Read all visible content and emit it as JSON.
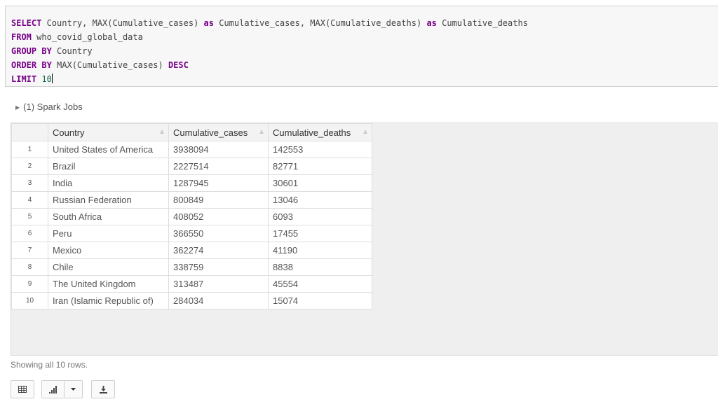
{
  "code": {
    "line1": {
      "kw1": "SELECT",
      "t1": " Country, MAX(Cumulative_cases) ",
      "kw2": "as",
      "t2": " Cumulative_cases, MAX(Cumulative_deaths) ",
      "kw3": "as",
      "t3": " Cumulative_deaths"
    },
    "line2": {
      "kw": "FROM",
      "t": " who_covid_global_data"
    },
    "line3": {
      "kw": "GROUP BY",
      "t": " Country"
    },
    "line4": {
      "kw": "ORDER BY",
      "t": " MAX(Cumulative_cases) ",
      "kw2": "DESC"
    },
    "line5": {
      "kw": "LIMIT",
      "t": " ",
      "num": "10"
    }
  },
  "spark_jobs": {
    "label": "(1) Spark Jobs"
  },
  "table": {
    "headers": [
      "Country",
      "Cumulative_cases",
      "Cumulative_deaths"
    ],
    "rows": [
      {
        "idx": "1",
        "country": "United States of America",
        "cases": "3938094",
        "deaths": "142553"
      },
      {
        "idx": "2",
        "country": "Brazil",
        "cases": "2227514",
        "deaths": "82771"
      },
      {
        "idx": "3",
        "country": "India",
        "cases": "1287945",
        "deaths": "30601"
      },
      {
        "idx": "4",
        "country": "Russian Federation",
        "cases": "800849",
        "deaths": "13046"
      },
      {
        "idx": "5",
        "country": "South Africa",
        "cases": "408052",
        "deaths": "6093"
      },
      {
        "idx": "6",
        "country": "Peru",
        "cases": "366550",
        "deaths": "17455"
      },
      {
        "idx": "7",
        "country": "Mexico",
        "cases": "362274",
        "deaths": "41190"
      },
      {
        "idx": "8",
        "country": "Chile",
        "cases": "338759",
        "deaths": "8838"
      },
      {
        "idx": "9",
        "country": "The United Kingdom",
        "cases": "313487",
        "deaths": "45554"
      },
      {
        "idx": "10",
        "country": "Iran (Islamic Republic of)",
        "cases": "284034",
        "deaths": "15074"
      }
    ]
  },
  "footer": {
    "rows_text": "Showing all 10 rows."
  },
  "toolbar": {
    "icons": [
      "table-icon",
      "bar-chart-icon",
      "caret-down-icon",
      "download-icon"
    ]
  }
}
